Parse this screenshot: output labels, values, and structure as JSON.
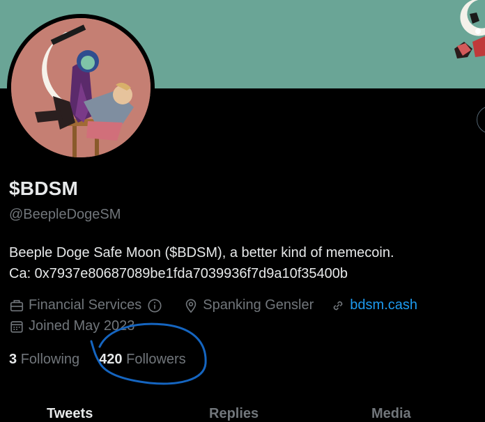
{
  "profile": {
    "display_name": "$BDSM",
    "handle": "@BeepleDogeSM",
    "bio_line1": "Beeple Doge Safe Moon ($BDSM), a better kind of memecoin.",
    "bio_line2": "Ca: 0x7937e80687089be1fda7039936f7d9a10f35400b"
  },
  "meta": {
    "category": "Financial Services",
    "location": "Spanking Gensler",
    "website": "bdsm.cash",
    "joined": "Joined May 2023"
  },
  "counts": {
    "following_num": "3",
    "following_label": "Following",
    "followers_num": "420",
    "followers_label": "Followers"
  },
  "tabs": [
    "Tweets",
    "Replies",
    "Media"
  ],
  "colors": {
    "banner": "#6aa596",
    "background": "#000000",
    "accent": "#1d9bf0",
    "secondary_text": "#71767b",
    "annotation": "#1565c0"
  }
}
